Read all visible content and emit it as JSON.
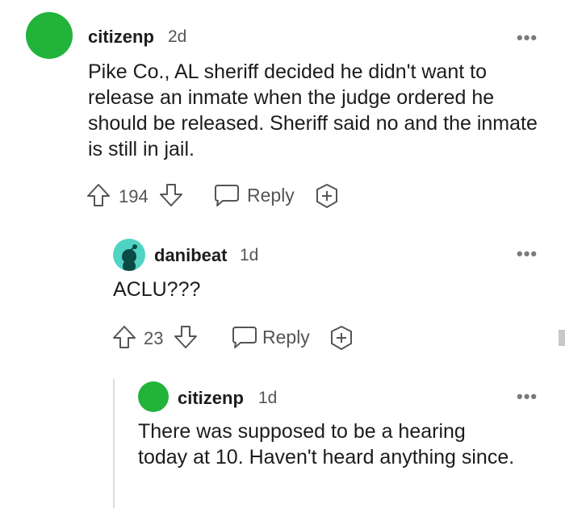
{
  "comments": [
    {
      "username": "citizenp",
      "time": "2d",
      "body": "Pike Co., AL sheriff decided he didn't want to release an inmate when the judge ordered he should be released. Sheriff said no and the inmate is still in jail.",
      "votes": "194",
      "reply_label": "Reply",
      "avatar_color": "#22b33a",
      "more_label": "•••"
    },
    {
      "username": "danibeat",
      "time": "1d",
      "body": "ACLU???",
      "votes": "23",
      "reply_label": "Reply",
      "avatar_color": "#4fd4c4",
      "more_label": "•••"
    },
    {
      "username": "citizenp",
      "time": "1d",
      "body": "There was supposed to be a hearing today at 10. Haven't heard anything since.",
      "avatar_color": "#22b33a",
      "more_label": "•••"
    }
  ],
  "icons": {
    "upvote": "upvote-arrow-icon",
    "downvote": "downvote-arrow-icon",
    "reply": "speech-bubble-icon",
    "award": "add-award-icon",
    "more": "more-options-icon"
  }
}
